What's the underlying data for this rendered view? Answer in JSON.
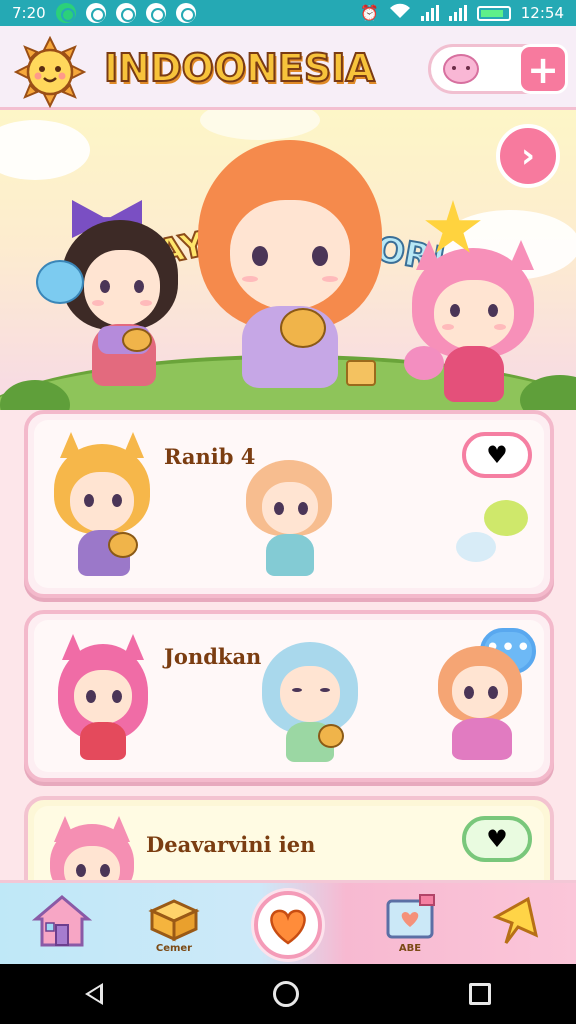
{
  "status_bar": {
    "time_left": "7:20",
    "time_right": "12:54"
  },
  "header": {
    "title": "INDOONESIA",
    "add_label": "+"
  },
  "banner": {
    "word_left": "LHAY",
    "word_right": "MOR!",
    "next_label": "›"
  },
  "cards": [
    {
      "title": "Ranib 4",
      "badge": "♥"
    },
    {
      "title": "Jondkan",
      "badge": "•••"
    },
    {
      "title": "Deavarvini ien",
      "badge": "♥"
    }
  ],
  "nav": {
    "item2_label": "Cemer",
    "item4_label": "ABE",
    "center_icon": "heart-icon"
  },
  "colors": {
    "status_bar": "#25a9b4",
    "accent_pink": "#f77a9e",
    "card_border": "#f3b9cb",
    "title_fill": "#f7c33b"
  }
}
